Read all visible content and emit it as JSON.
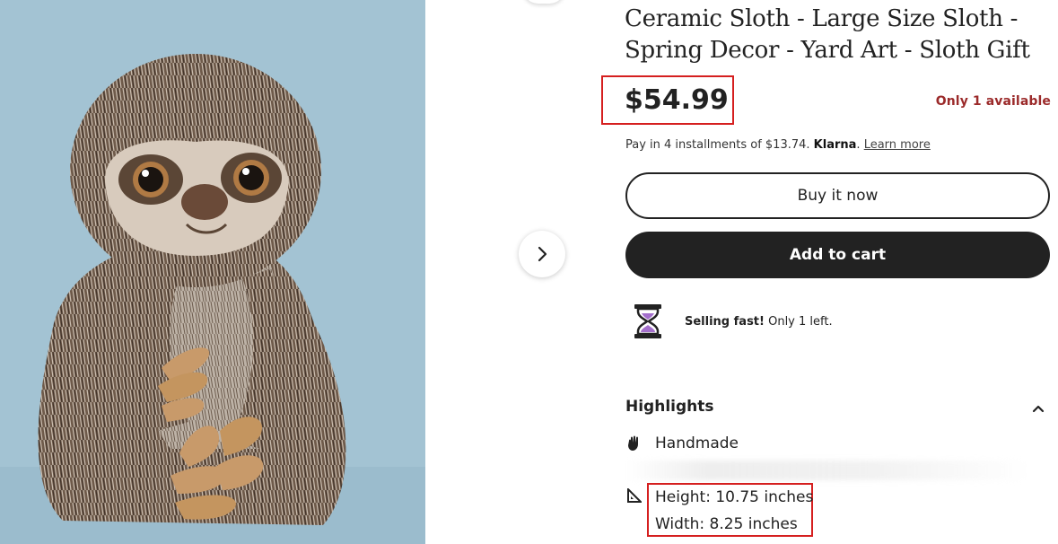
{
  "product": {
    "title": "Ceramic Sloth - Large Size Sloth - Spring Decor - Yard Art - Sloth Gift",
    "price": "$54.99",
    "stock_notice": "Only 1 available",
    "installments": {
      "text": "Pay in 4 installments of $13.74.",
      "provider": "Klarna",
      "period": ".",
      "learn_more": "Learn more"
    }
  },
  "actions": {
    "buy_now": "Buy it now",
    "add_to_cart": "Add to cart"
  },
  "selling_fast": {
    "bold": "Selling fast!",
    "text": "Only 1 left."
  },
  "highlights": {
    "heading": "Highlights",
    "items": [
      {
        "icon": "hand-icon",
        "label": "Handmade"
      }
    ],
    "dimensions": {
      "height": "Height: 10.75 inches",
      "width": "Width: 8.25 inches"
    }
  },
  "colors": {
    "annotation_red": "#d51f1f",
    "stock_red": "#9b2a2a",
    "dark_button": "#222222",
    "photo_background": "#a3c3d3"
  }
}
